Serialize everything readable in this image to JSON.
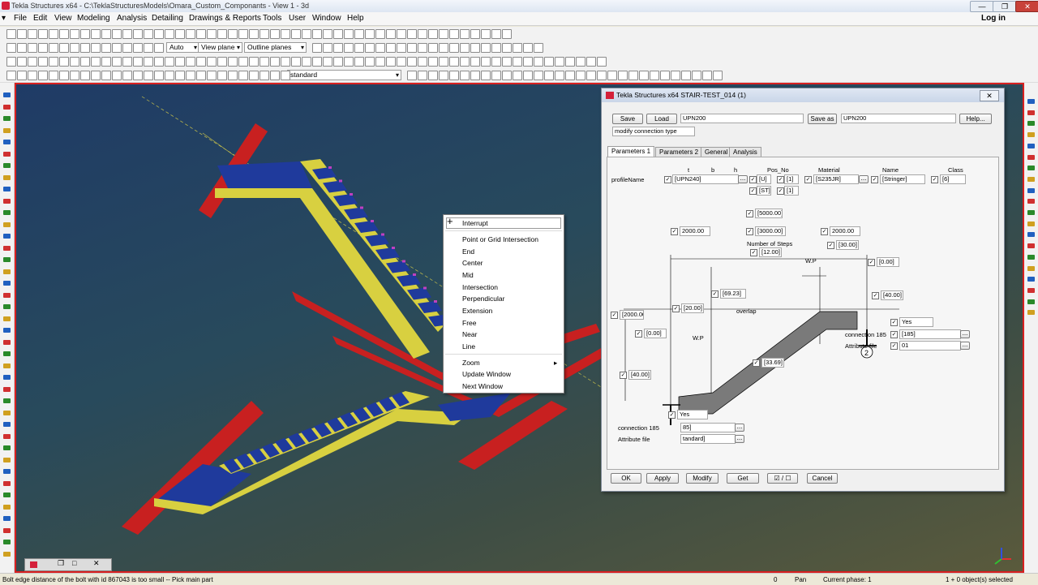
{
  "window": {
    "title": "Tekla Structures x64 - C:\\TeklaStructuresModels\\Omara_Custom_Componants  - View 1 - 3d",
    "login": "Log in"
  },
  "menu": [
    "File",
    "Edit",
    "View",
    "Modeling",
    "Analysis",
    "Detailing",
    "Drawings & Reports",
    "Tools",
    "User",
    "Window",
    "Help"
  ],
  "toolbar": {
    "work_plane": "Auto",
    "view_plane": "View plane",
    "outline": "Outline planes",
    "standard": "standard"
  },
  "context_menu": {
    "items": [
      "Interrupt",
      "Point or Grid Intersection",
      "End",
      "Center",
      "Mid",
      "Intersection",
      "Perpendicular",
      "Extension",
      "Free",
      "Near",
      "Line",
      "Zoom",
      "Update Window",
      "Next Window"
    ]
  },
  "dialog": {
    "title": "Tekla Structures x64  STAIR-TEST_014 (1)",
    "save": "Save",
    "load": "Load",
    "load_value": "UPN200",
    "save_as": "Save as",
    "save_as_value": "UPN200",
    "help": "Help...",
    "modify_type": "modify connection type",
    "tabs": [
      "Parameters 1",
      "Parameters 2",
      "General",
      "Analysis"
    ],
    "headers": {
      "t": "t",
      "b": "b",
      "h": "h",
      "pos": "Pos_No",
      "material": "Material",
      "name": "Name",
      "class": "Class"
    },
    "profile": {
      "label": "profileName",
      "value": "[UPN240]",
      "pos_a1": "[U]",
      "pos_a2": "[1]",
      "pos_b1": "[ST]",
      "pos_b2": "[1]",
      "material": "[S235JR]",
      "name": "[Stringer]",
      "class": "[6]"
    },
    "dims": {
      "total": "[5000.00]",
      "left": "2000.00",
      "mid": "[3000.00]",
      "right": "2000.00",
      "steps_label": "Number of Steps",
      "steps": "[12.00]",
      "step_top": "[30.00]",
      "top_off": "[0.00]",
      "right_off": "[40.00]",
      "angle": "[69.23]",
      "height": "[2000.00]",
      "left_d": "[20.00]",
      "overlap": "overlap",
      "zero": "[0.00]",
      "bottom": "[40.00]",
      "slope": "[33.69]",
      "wp": "W.P",
      "one": "1",
      "two": "2"
    },
    "conn_top": {
      "yes": "Yes",
      "label": "connection 185",
      "value": "[185]",
      "attr_label": "Attribute file",
      "attr": "01"
    },
    "conn_bottom": {
      "yes": "Yes",
      "label": "connection 185",
      "value": "85]",
      "attr_label": "Attribute file",
      "attr": "tandard]"
    },
    "buttons": {
      "ok": "OK",
      "apply": "Apply",
      "modify": "Modify",
      "get": "Get",
      "toggle": "☑ / ☐",
      "cancel": "Cancel"
    }
  },
  "status": {
    "message": "Bolt edge distance of the bolt with id 867043 is too small -- Pick main part",
    "zero": "0",
    "pan": "Pan",
    "phase": "Current phase: 1",
    "selected": "1 + 0 object(s) selected"
  },
  "colors": {
    "stringer": "#c82020",
    "flange": "#d8d040",
    "tread": "#1f3a9c",
    "frame": "#d82020"
  }
}
